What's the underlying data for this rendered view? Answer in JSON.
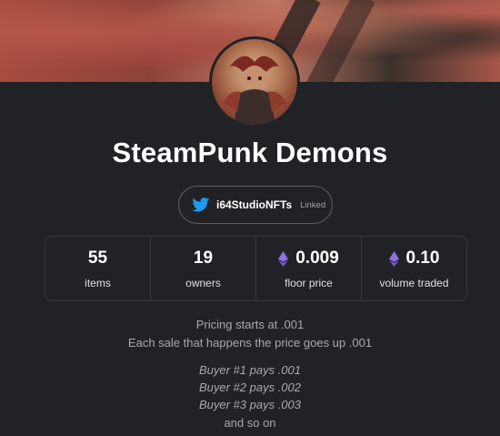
{
  "collection": {
    "title": "SteamPunk Demons",
    "avatar_icon": "collection-avatar"
  },
  "twitter": {
    "handle": "i64StudioNFTs",
    "status": "Linked",
    "icon": "twitter-icon",
    "icon_color": "#1d9bf0"
  },
  "stats": {
    "items": {
      "value": "55",
      "label": "items"
    },
    "owners": {
      "value": "19",
      "label": "owners"
    },
    "floor_price": {
      "value": "0.009",
      "label": "floor price",
      "icon": "ethereum-icon"
    },
    "volume_traded": {
      "value": "0.10",
      "label": "volume traded",
      "icon": "ethereum-icon"
    }
  },
  "eth_icon_color": "#8f6ee8",
  "description": {
    "line1": "Pricing starts at .001",
    "line2": "Each sale that happens the price goes up .001",
    "examples": [
      "Buyer #1 pays .001",
      "Buyer #2 pays .002",
      "Buyer #3 pays .003"
    ],
    "closing": "and so on"
  }
}
